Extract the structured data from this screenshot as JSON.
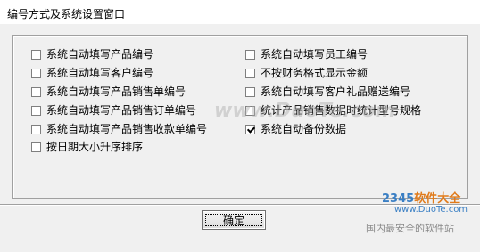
{
  "window": {
    "title": "编号方式及系统设置窗口"
  },
  "options_left": [
    {
      "label": "系统自动填写产品编号",
      "checked": false
    },
    {
      "label": "系统自动填写客户编号",
      "checked": false
    },
    {
      "label": "系统自动填写产品销售单编号",
      "checked": false
    },
    {
      "label": "系统自动填写产品销售订单编号",
      "checked": false
    },
    {
      "label": "系统自动填写产品销售收款单编号",
      "checked": false
    },
    {
      "label": "按日期大小升序排序",
      "checked": false
    }
  ],
  "options_right": [
    {
      "label": "系统自动填写员工编号",
      "checked": false
    },
    {
      "label": "不按财务格式显示金额",
      "checked": false
    },
    {
      "label": "系统自动填写客户礼品赠送编号",
      "checked": false
    },
    {
      "label": "统计产品销售数据时统计型号规格",
      "checked": false
    },
    {
      "label": "系统自动备份数据",
      "checked": true
    }
  ],
  "buttons": {
    "ok_label": "确定"
  },
  "watermarks": {
    "center": "www.DuoTe.com",
    "brand_number": "2345",
    "brand_text": "软件大全",
    "url": "www.DuoTe.com",
    "slogan": "国内最安全的软件站"
  }
}
